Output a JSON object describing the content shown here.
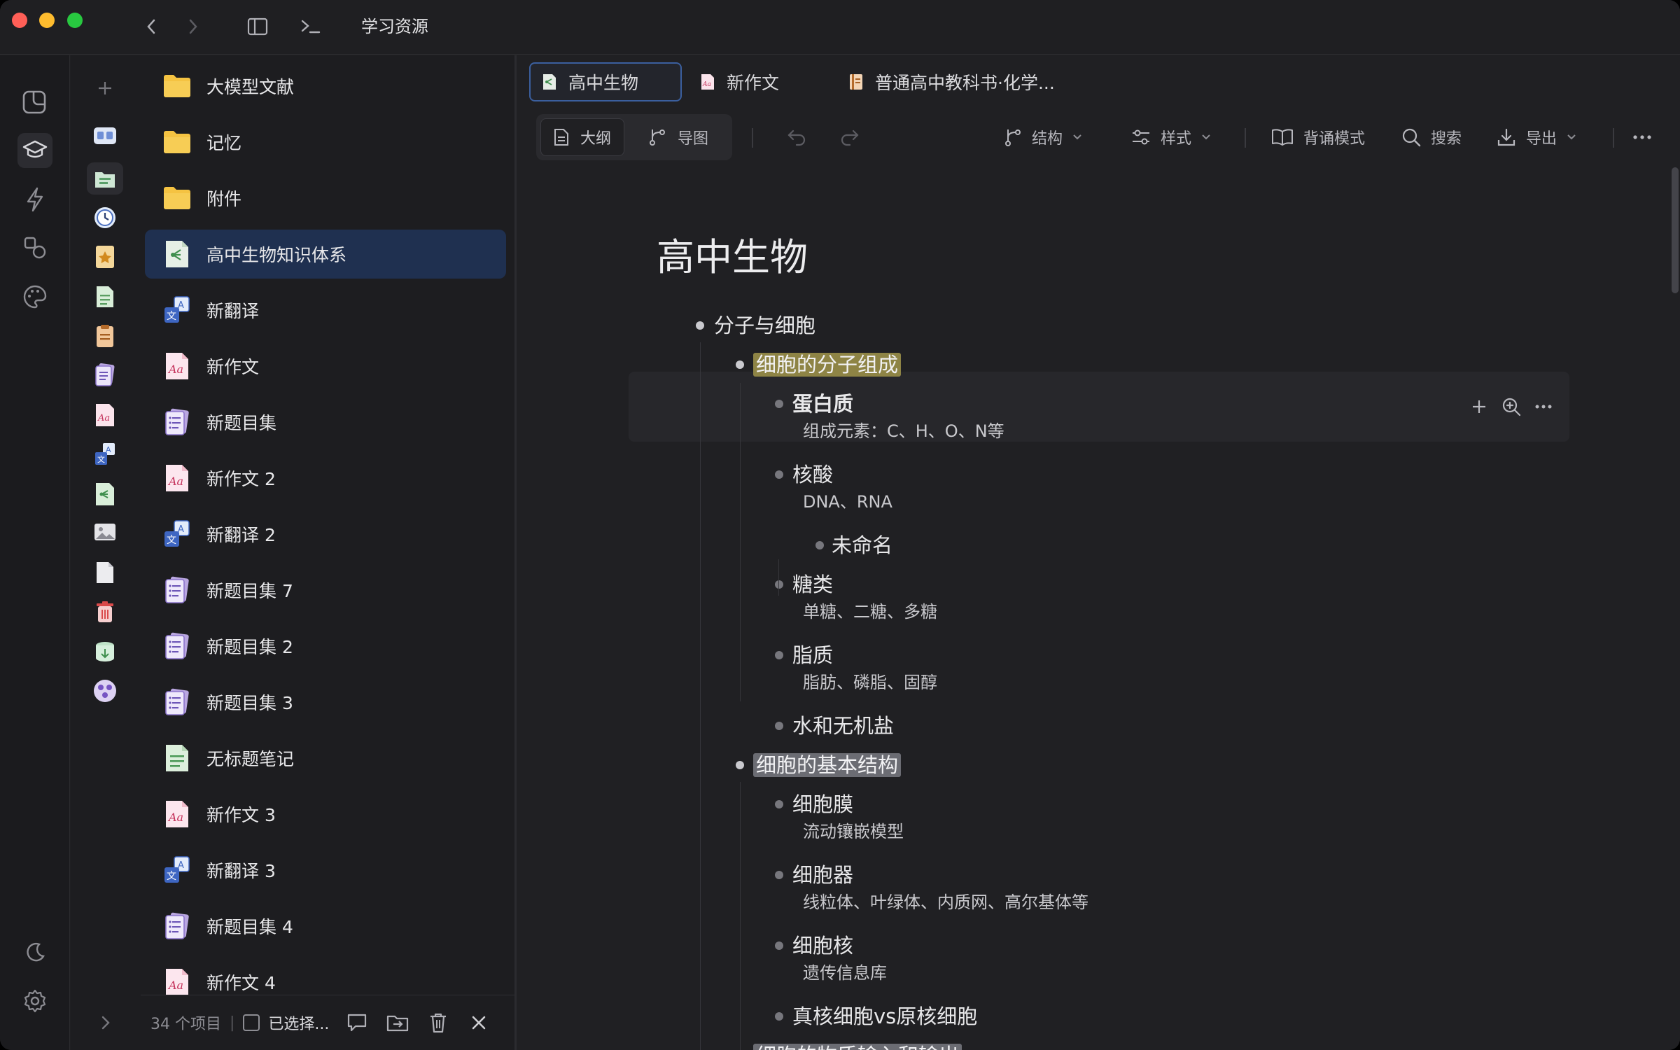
{
  "window": {
    "title": "学习资源"
  },
  "file_list": {
    "items": [
      {
        "label": "大模型文献",
        "icon": "folder-icon",
        "type": "folder"
      },
      {
        "label": "记忆",
        "icon": "folder-icon",
        "type": "folder"
      },
      {
        "label": "附件",
        "icon": "folder-icon",
        "type": "folder"
      },
      {
        "label": "高中生物知识体系",
        "icon": "mindmap-file-icon",
        "type": "mindmap",
        "selected": true
      },
      {
        "label": "新翻译",
        "icon": "translate-file-icon",
        "type": "translate"
      },
      {
        "label": "新作文",
        "icon": "essay-file-icon",
        "type": "essay"
      },
      {
        "label": "新题目集",
        "icon": "question-set-icon",
        "type": "questions"
      },
      {
        "label": "新作文 2",
        "icon": "essay-file-icon",
        "type": "essay"
      },
      {
        "label": "新翻译 2",
        "icon": "translate-file-icon",
        "type": "translate"
      },
      {
        "label": "新题目集 7",
        "icon": "question-set-icon",
        "type": "questions"
      },
      {
        "label": "新题目集 2",
        "icon": "question-set-icon",
        "type": "questions"
      },
      {
        "label": "新题目集 3",
        "icon": "question-set-icon",
        "type": "questions"
      },
      {
        "label": "无标题笔记",
        "icon": "note-file-icon",
        "type": "note"
      },
      {
        "label": "新作文 3",
        "icon": "essay-file-icon",
        "type": "essay"
      },
      {
        "label": "新翻译 3",
        "icon": "translate-file-icon",
        "type": "translate"
      },
      {
        "label": "新题目集 4",
        "icon": "question-set-icon",
        "type": "questions"
      },
      {
        "label": "新作文 4",
        "icon": "essay-file-icon",
        "type": "essay"
      }
    ],
    "count_label": "34 个项目",
    "separator": "|",
    "selected_label": "已选择..."
  },
  "tabs": [
    {
      "label": "高中生物",
      "icon": "mindmap-file-icon",
      "active": true
    },
    {
      "label": "新作文",
      "icon": "essay-file-icon",
      "active": false
    },
    {
      "label": "普通高中教科书·化学...",
      "icon": "book-file-icon",
      "active": false
    }
  ],
  "toolbar": {
    "outline_label": "大纲",
    "mindmap_label": "导图",
    "structure_label": "结构",
    "style_label": "样式",
    "recite_label": "背诵模式",
    "search_label": "搜索",
    "export_label": "导出"
  },
  "document": {
    "title": "高中生物",
    "nodes": [
      {
        "text": "分子与细胞",
        "level": 0
      },
      {
        "text": "细胞的分子组成",
        "level": 1,
        "highlight": "yellow"
      },
      {
        "text": "蛋白质",
        "level": 2,
        "bold": true,
        "note": "组成元素：C、H、O、N等",
        "hovered": true
      },
      {
        "text": "核酸",
        "level": 2,
        "note": "DNA、RNA"
      },
      {
        "text": "未命名",
        "level": 3
      },
      {
        "text": "糖类",
        "level": 2,
        "note": "单糖、二糖、多糖"
      },
      {
        "text": "脂质",
        "level": 2,
        "note": "脂肪、磷脂、固醇"
      },
      {
        "text": "水和无机盐",
        "level": 2
      },
      {
        "text": "细胞的基本结构",
        "level": 1,
        "highlight": "gray"
      },
      {
        "text": "细胞膜",
        "level": 2,
        "note": "流动镶嵌模型"
      },
      {
        "text": "细胞器",
        "level": 2,
        "note": "线粒体、叶绿体、内质网、高尔基体等"
      },
      {
        "text": "细胞核",
        "level": 2,
        "note": "遗传信息库"
      },
      {
        "text": "真核细胞vs原核细胞",
        "level": 2
      },
      {
        "text": "细胞的物质输入和输出",
        "level": 1,
        "highlight": "gray"
      }
    ]
  },
  "colors": {
    "accent": "#3b5f9e",
    "selection": "#1f3050",
    "highlight_yellow": "#8e8445",
    "highlight_gray": "#6b6c73"
  }
}
